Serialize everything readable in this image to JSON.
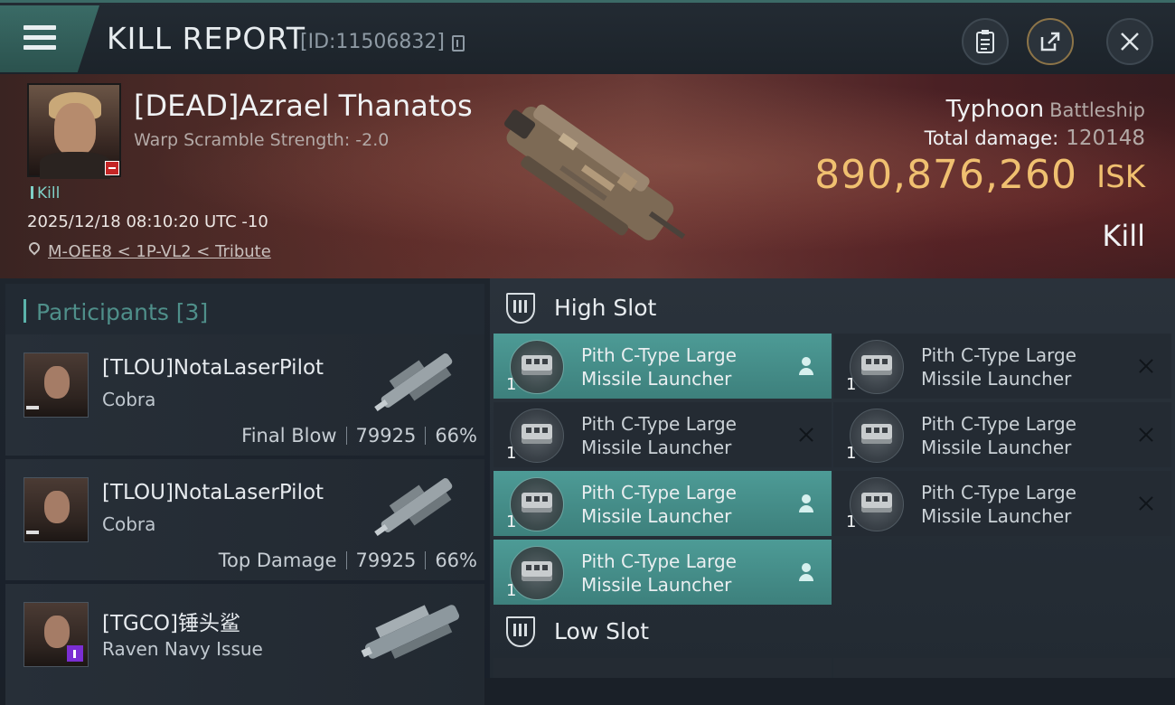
{
  "header": {
    "title": "KILL REPORT",
    "report_id": "[ID:11506832]",
    "icons": [
      "menu-icon",
      "copy-icon",
      "clipboard-icon",
      "share-icon",
      "close-icon"
    ]
  },
  "victim": {
    "name": "[DEAD]Azrael Thanatos",
    "warp_scramble": "Warp Scramble Strength: -2.0",
    "kill_tag": "Kill",
    "datetime": "2025/12/18 08:10:20 UTC -10",
    "location": "M-OEE8 < 1P-VL2 < Tribute",
    "ship_name": "Typhoon",
    "ship_class": "Battleship",
    "total_damage_label": "Total damage:",
    "total_damage": "120148",
    "isk_value": "890,876,260",
    "isk_unit": "ISK",
    "result": "Kill"
  },
  "participants": {
    "title": "Participants [3]",
    "items": [
      {
        "name": "[TLOU]NotaLaserPilot",
        "ship": "Cobra",
        "role": "Final Blow",
        "damage": "79925",
        "percent": "66%"
      },
      {
        "name": "[TLOU]NotaLaserPilot",
        "ship": "Cobra",
        "role": "Top Damage",
        "damage": "79925",
        "percent": "66%"
      },
      {
        "name": "[TGCO]锤头鲨",
        "ship": "Raven Navy Issue"
      }
    ]
  },
  "fittings": {
    "high_slot_title": "High Slot",
    "low_slot_title": "Low Slot",
    "modules": [
      {
        "line1": "Pith C-Type Large",
        "line2": "Missile Launcher",
        "qty": "1",
        "status": "fitted"
      },
      {
        "line1": "Pith C-Type Large",
        "line2": "Missile Launcher",
        "qty": "1",
        "status": "destroyed"
      },
      {
        "line1": "Pith C-Type Large",
        "line2": "Missile Launcher",
        "qty": "1",
        "status": "destroyed"
      },
      {
        "line1": "Pith C-Type Large",
        "line2": "Missile Launcher",
        "qty": "1",
        "status": "destroyed"
      },
      {
        "line1": "Pith C-Type Large",
        "line2": "Missile Launcher",
        "qty": "1",
        "status": "fitted"
      },
      {
        "line1": "Pith C-Type Large",
        "line2": "Missile Launcher",
        "qty": "1",
        "status": "destroyed"
      },
      {
        "line1": "Pith C-Type Large",
        "line2": "Missile Launcher",
        "qty": "1",
        "status": "fitted"
      }
    ]
  },
  "colors": {
    "accent_teal": "#4d9b96",
    "isk_gold": "#f0c070",
    "dead_red": "#c42525"
  }
}
